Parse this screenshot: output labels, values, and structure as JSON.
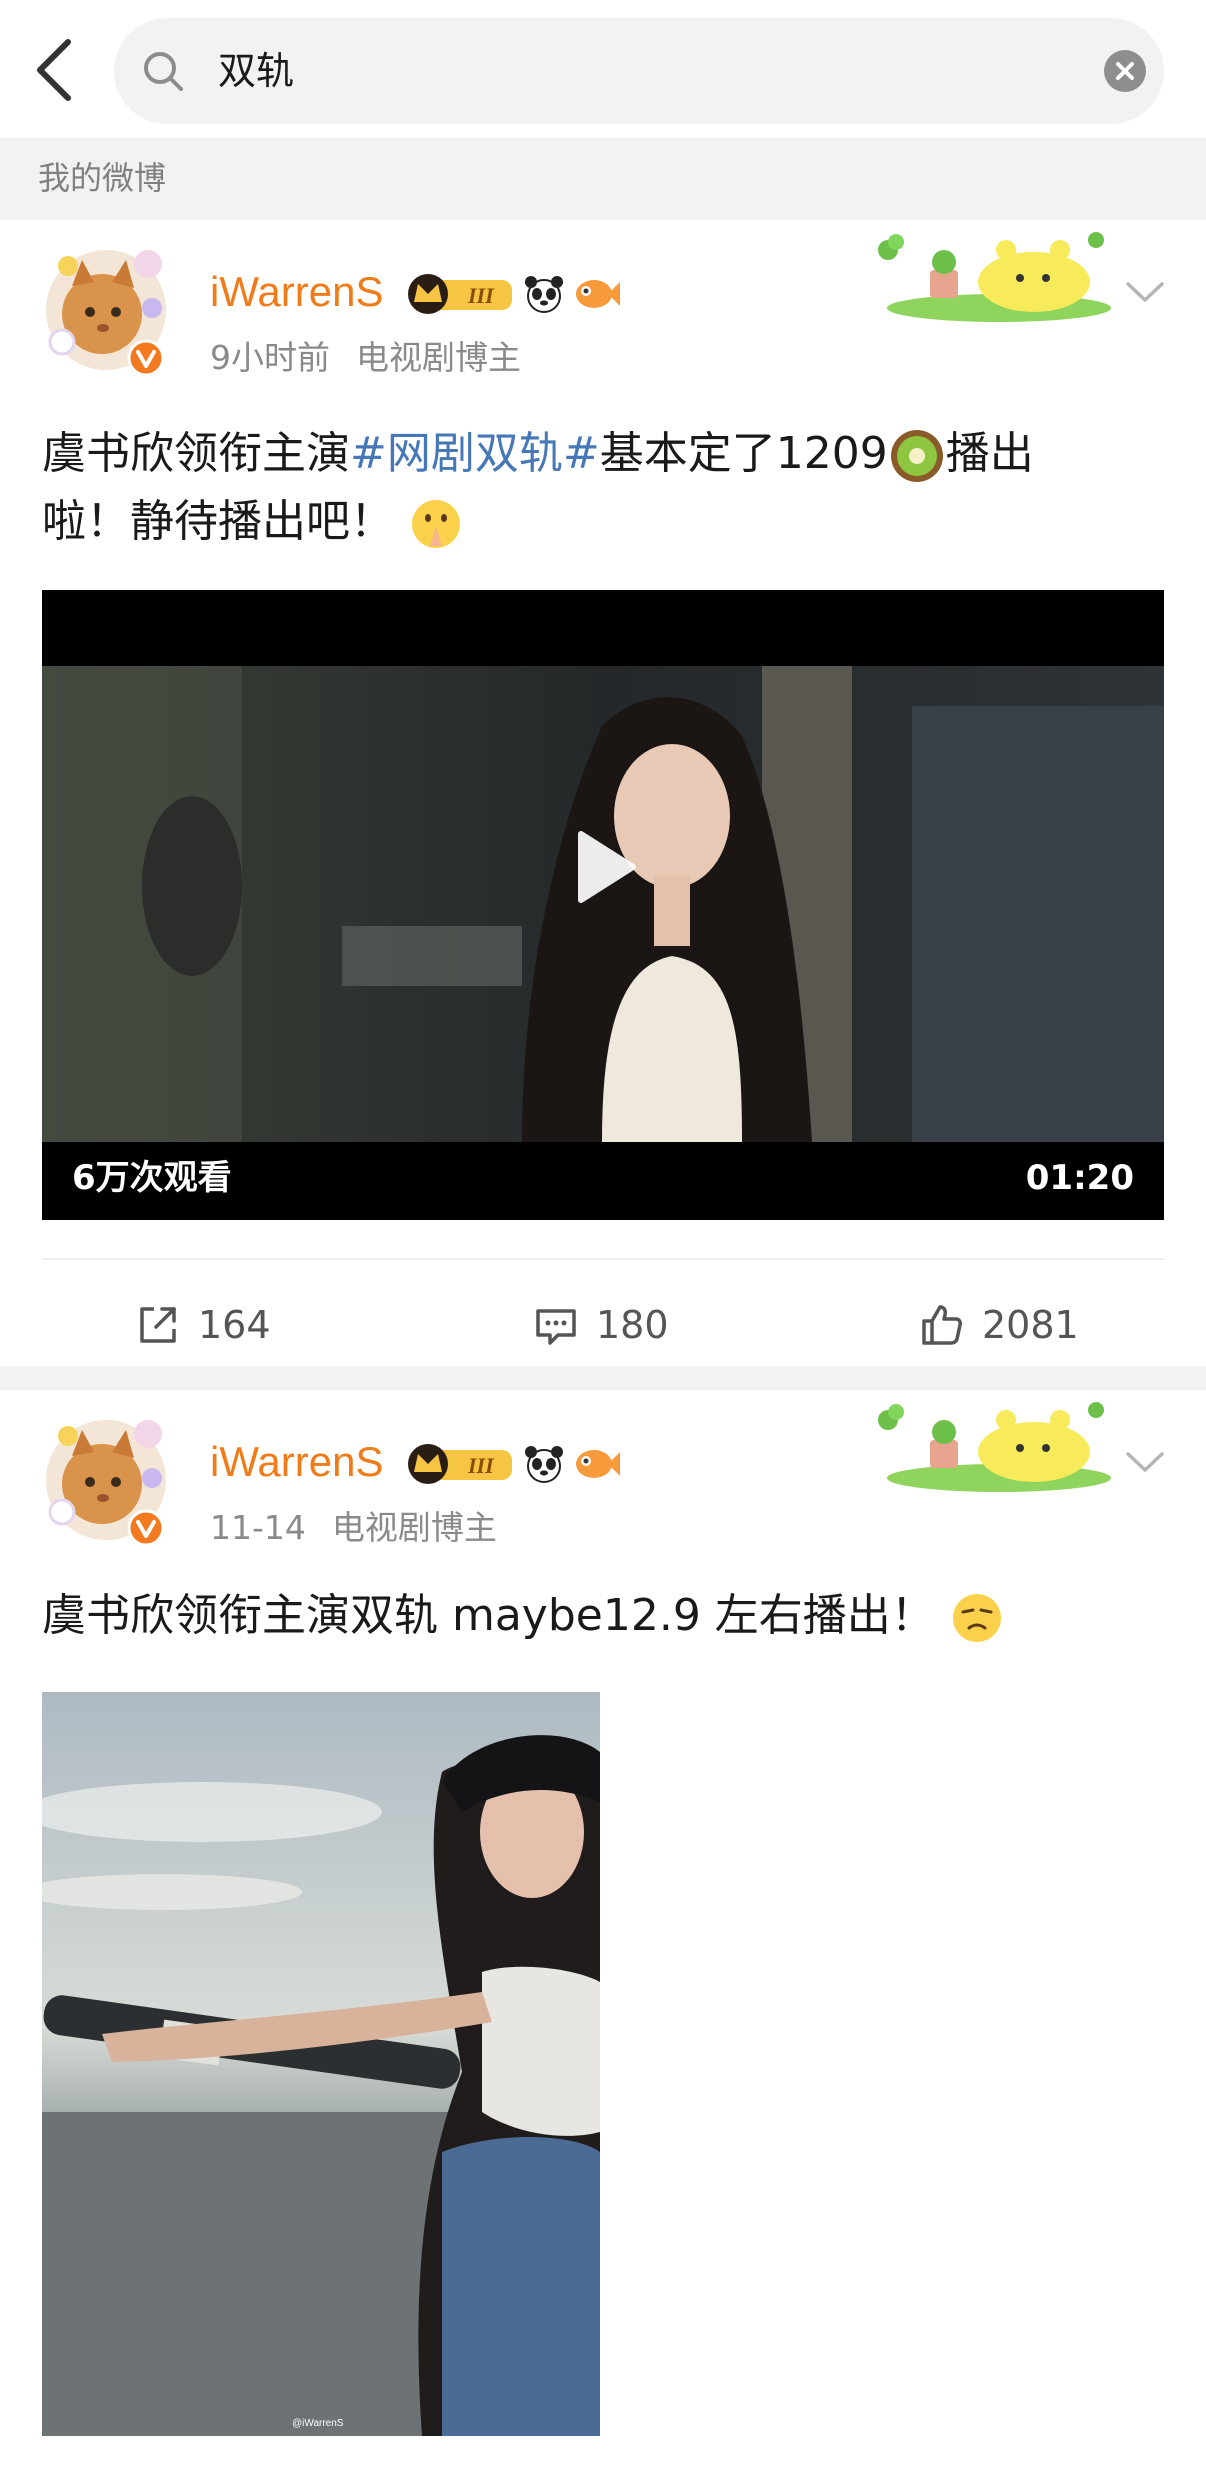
{
  "search": {
    "query": "双轨"
  },
  "section": {
    "label": "我的微博"
  },
  "posts": [
    {
      "username": "iWarrenS",
      "time": "9小时前",
      "source": "电视剧博主",
      "text_before": "虞书欣领衔主演",
      "topic": "#网剧双轨#",
      "text_mid": "基本定了1209",
      "text_after": "播出",
      "text_line2": "啦！静待播出吧！",
      "video": {
        "views": "6万次观看",
        "duration": "01:20"
      },
      "actions": {
        "repost": "164",
        "comment": "180",
        "like": "2081"
      }
    },
    {
      "username": "iWarrenS",
      "time": "11-14",
      "source": "电视剧博主",
      "text": "虞书欣领衔主演双轨 maybe12.9 左右播出！",
      "watermark": "@iWarrenS"
    }
  ],
  "colors": {
    "username": "#ef7c19",
    "topic": "#4677b6",
    "meta": "#8a8a8a"
  }
}
